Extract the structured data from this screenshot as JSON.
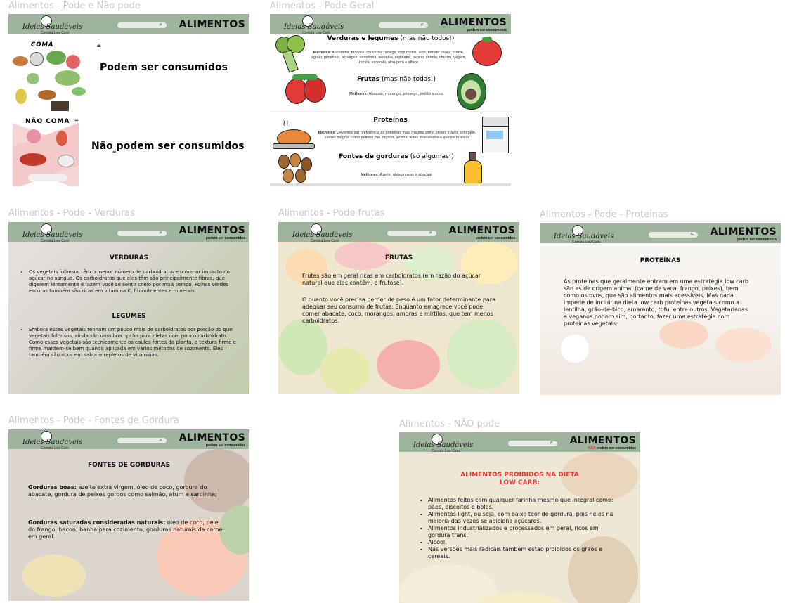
{
  "frames": {
    "pode_e_nao_pode": {
      "label": "Alimentos - Pode e Não pode",
      "coma_label": "COMA",
      "coma_text": "Podem ser consumidos",
      "nao_coma_label": "NÃO COMA",
      "nao_coma_text": "Não podem ser consumidos"
    },
    "pode_geral": {
      "label": "Alimentos - Pode Geral",
      "verduras_title": "Verduras e legumes",
      "verduras_note": "(mas não todos!)",
      "verduras_best_label": "Melhores",
      "verduras_best": ": Abobrinha, brócolis, couve-flor, acelga, cogumelos, aipo, tomate cereja, couve, agrião, pimentão, aspargos, abobrinha, berinjela, espinafre, pepino, cebola, chuchu, vagem, rúcula, escarola, alho-poró e alface",
      "frutas_title": "Frutas",
      "frutas_note": "(mas não todas!)",
      "frutas_best_label": "Melhores",
      "frutas_best": ": Abacate, morango, pêssego, melão e coco",
      "proteinas_title": "Proteínas",
      "proteinas_best_label": "Melhores",
      "proteinas_best": ": Devemos dar preferência às proteínas mais magras como peixes e aves sem pele, carnes magras como patinho, filé mignon, alcatra, leites desnatados e queijos brancos",
      "gorduras_title": "Fontes de gorduras",
      "gorduras_note": "(só algumas!)",
      "gorduras_best_label": "Melhores",
      "gorduras_best": ": Azeite, oleaginosas e abacate"
    },
    "verduras": {
      "label": "Alimentos - Pode - Verduras",
      "title": "VERDURAS",
      "text": "Os vegetais folhosos têm o menor número de carboidratos e o menor impacto no açúcar no sangue. Os carboidratos que eles têm são principalmente fibras, que digerem lentamente e fazem você se sentir cheio por mais tempo. Folhas verdes escuras também são ricas em vitamina K, fitonutrientes e minerais.",
      "subtitle": "LEGUMES",
      "text2": "Embora esses vegetais tenham um pouco mais de carboidratos por porção do que vegetais folhosos, ainda são uma boa opção para dietas com pouco carboidrato. Como esses vegetais são tecnicamente os caules fortes da planta, a textura firme e firme mantém-se bem quando aplicada em vários métodos de cozimento. Eles também são ricos em sabor e repletos de vitaminas."
    },
    "frutas": {
      "label": "Alimentos - Pode frutas",
      "title": "FRUTAS",
      "p1": "Frutas são em geral ricas em carboidratos (em razão do açúcar natural que elas contêm, a frutose).",
      "p2": "O quanto você precisa perder de peso é um fator determinante para adequar seu consumo de frutas. Enquanto emagrece você pode comer abacate, coco, morangos, amoras e mirtilos, que tem menos carboidratos."
    },
    "proteinas": {
      "label": "Alimentos - Pode - Proteínas",
      "title": "PROTEÍNAS",
      "text": "As proteínas que geralmente entram em uma estratégia low carb são as de origem animal (carne de vaca, frango, peixes), bem como os ovos, que são alimentos mais acessíveis. Mas nada impede de incluir na dieta low carb proteínas vegetais como a lentilha, grão-de-bico, amaranto, tofu, entre outros. Vegetarianas e veganos podem sim, portanto, fazer uma estratégia com proteínas vegetais."
    },
    "gorduras": {
      "label": "Alimentos - Pode - Fontes de Gordura",
      "title": "FONTES DE GORDURAS",
      "b1_label": "Gorduras boas:",
      "b1_text": " azeite extra virgem, óleo de coco, gordura do abacate, gordura de peixes gordos como salmão, atum e sardinha;",
      "b2_label": "Gorduras saturadas consideradas naturais:",
      "b2_text": " óleo de coco, pele do frango, bacon, banha para cozimento, gorduras naturais da carne em geral."
    },
    "nao_pode": {
      "label": "Alimentos - NÃO pode",
      "title_line1": "ALIMENTOS PROIBIDOS NA DIETA",
      "title_line2": "LOW CARB:",
      "items": [
        "Alimentos feitos com qualquer farinha mesmo que integral como: pães, biscoitos e bolos.",
        "Alimentos light, ou seja, com baixo teor de gordura, pois neles na maioria das vezes se adiciona açúcares.",
        "Alimentos industrializados e processados em geral, ricos em gordura trans.",
        "Álcool.",
        "Nas versões mais radicais também estão proibidos os grãos e cereais."
      ]
    }
  },
  "header": {
    "brand": "Ideias Saudáveis",
    "brand_sub": "Comida Low Carb",
    "title": "ALIMENTOS",
    "subtitle": "podem ser consumidos",
    "nao": "NÃO",
    "search_icon": "search-icon"
  }
}
